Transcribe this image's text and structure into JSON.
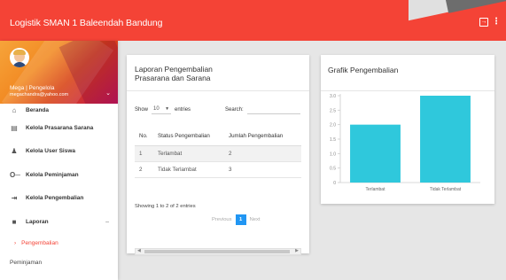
{
  "app": {
    "title": "Logistik SMAN 1 Baleendah Bandung"
  },
  "topbar": {
    "exit_icon": "logout-icon",
    "more_icon": "more-vert-icon"
  },
  "colors": {
    "primary": "#f44336",
    "bar": "#2fc8dc",
    "pager_active": "#2196f3"
  },
  "user": {
    "name": "Mega | Pengelola",
    "email": "megachandra@yahoo.com"
  },
  "sidebar": {
    "items": [
      {
        "label": "Beranda",
        "icon": "home-icon",
        "glyph": "⌂"
      },
      {
        "label": "Kelola Prasarana Sarana",
        "icon": "building-icon",
        "glyph": "▤"
      },
      {
        "label": "Kelola User Siswa",
        "icon": "people-icon",
        "glyph": "♟"
      },
      {
        "label": "Kelola Peminjaman",
        "icon": "key-icon",
        "glyph": "O─"
      },
      {
        "label": "Kelola Pengembalian",
        "icon": "return-icon",
        "glyph": "⇥"
      },
      {
        "label": "Laporan",
        "icon": "report-icon",
        "glyph": "■"
      }
    ],
    "laporan_toggle": "–",
    "submenu": [
      {
        "label": "Pengembalian",
        "arrow": "›"
      },
      {
        "label": "Peminjaman"
      }
    ]
  },
  "report_card": {
    "title_line1": "Laporan Pengembalian",
    "title_line2": "Prasarana dan Sarana",
    "show_label": "Show",
    "entries_value": "10",
    "entries_label": "entries",
    "search_label": "Search:",
    "search_value": "",
    "columns": [
      "No.",
      "Status Pengembalian",
      "Jumlah Pengembalian"
    ],
    "rows": [
      [
        "1",
        "Terlambat",
        "2"
      ],
      [
        "2",
        "Tidak Terlambat",
        "3"
      ]
    ],
    "info": "Showing 1 to 2 of 2 entries",
    "pager": {
      "previous": "Previous",
      "page": "1",
      "next": "Next"
    }
  },
  "chart_card": {
    "title": "Grafik Pengembalian"
  },
  "chart_data": {
    "type": "bar",
    "categories": [
      "Terlambat",
      "Tidak Terlambat"
    ],
    "values": [
      2,
      3
    ],
    "ylim": [
      0,
      3
    ],
    "yticks": [
      "0",
      "0.5",
      "1.0",
      "1.5",
      "2.0",
      "2.5",
      "3.0"
    ],
    "grid": false,
    "bar_color": "#2fc8dc"
  }
}
